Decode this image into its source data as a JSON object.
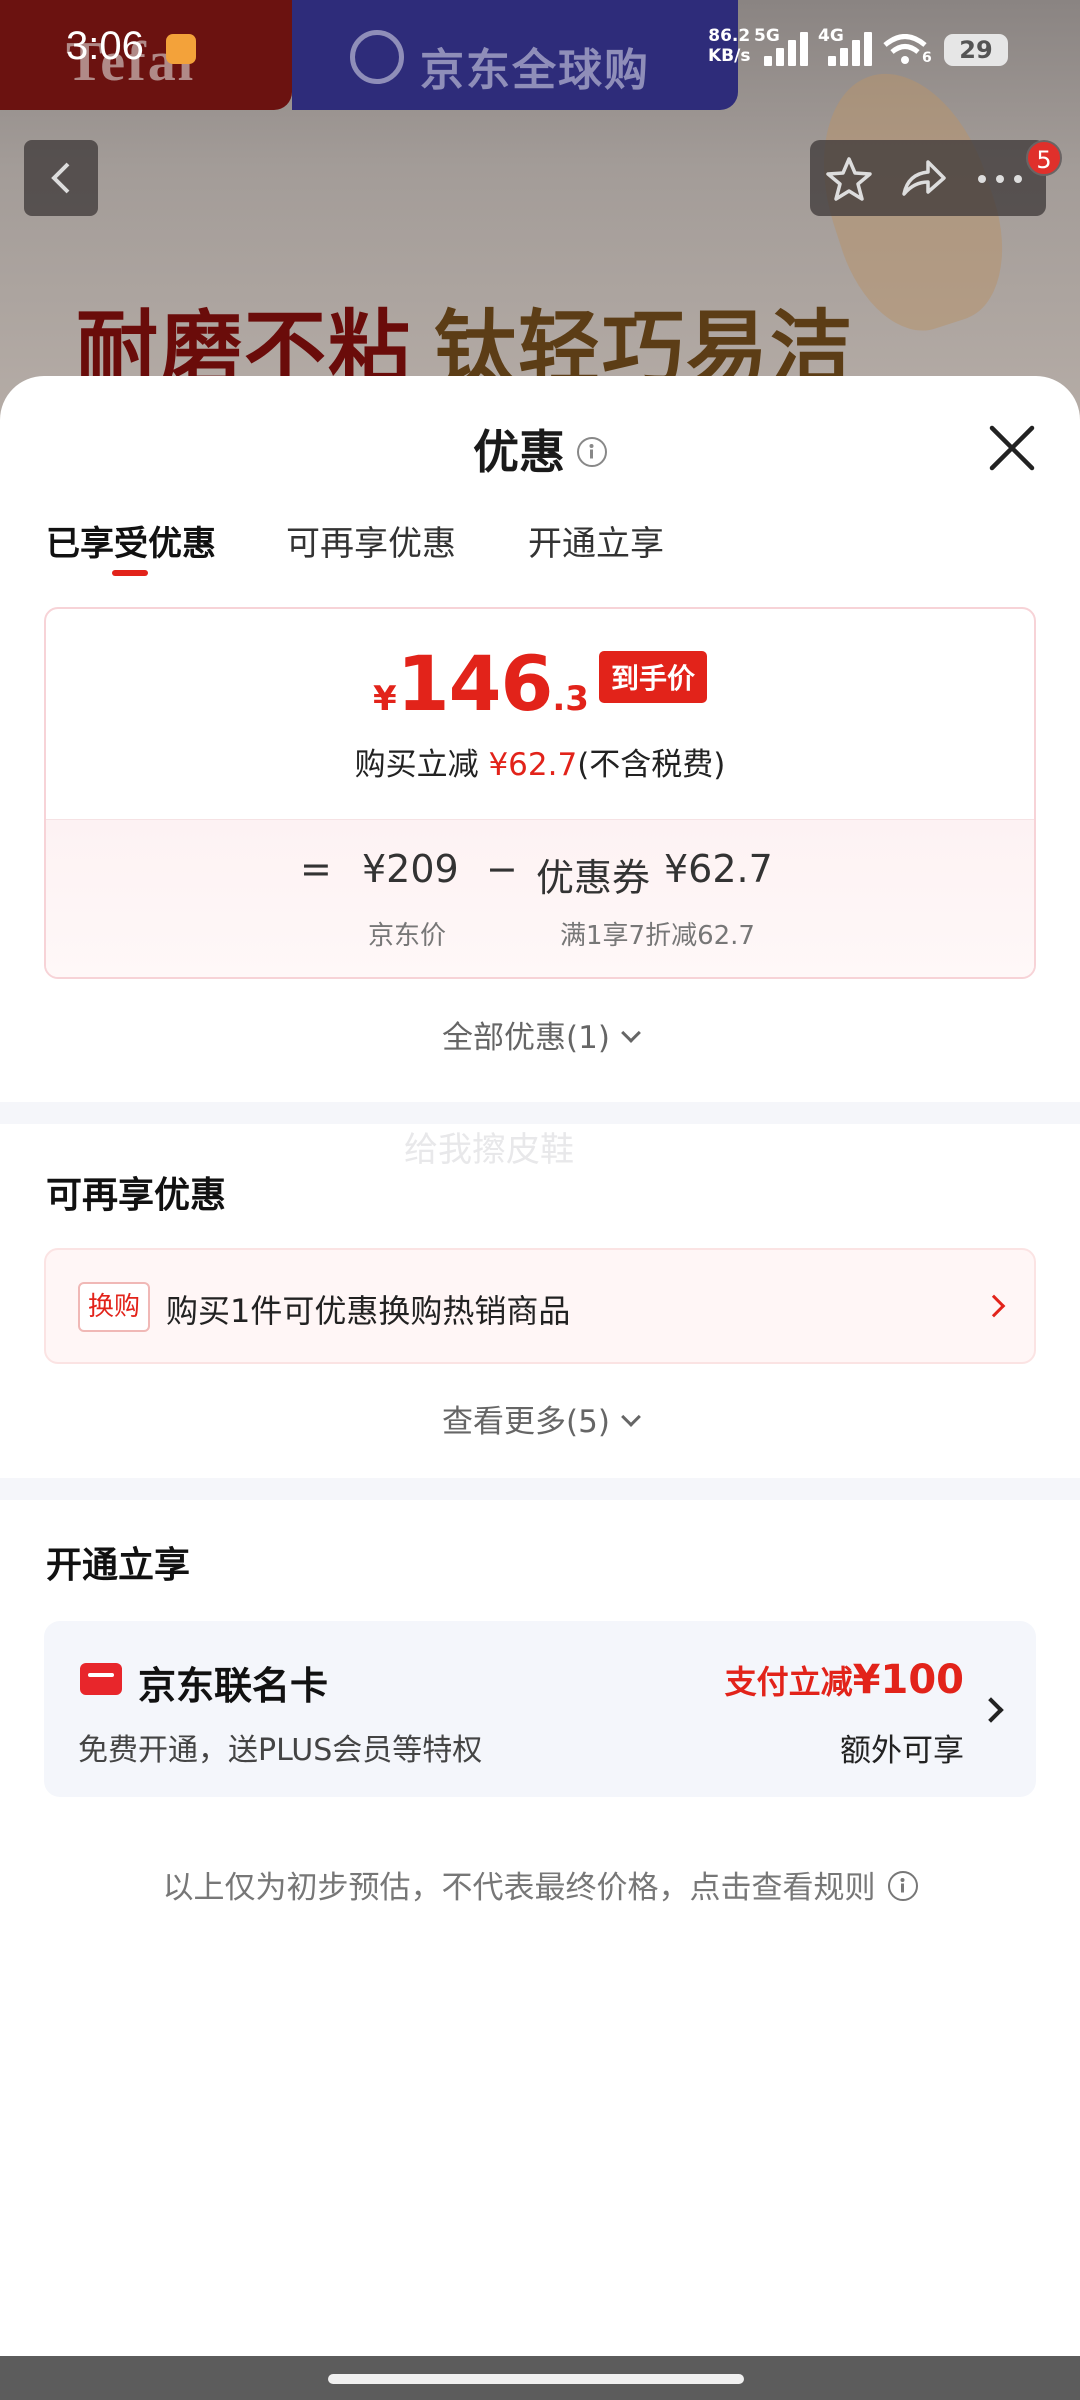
{
  "status_bar": {
    "time": "3:06",
    "net_speed_value": "86.2",
    "net_speed_unit": "KB/s",
    "signal1_label": "5G",
    "signal2_label": "4G",
    "wifi_sub": "6",
    "battery": "29"
  },
  "background": {
    "brand_left": "Tefal",
    "brand_right": "京东全球购",
    "slogan_part1": "耐磨不粘",
    "slogan_part2": "钛轻巧易洁",
    "nav_badge_count": "5"
  },
  "sheet": {
    "title": "优惠",
    "tabs": [
      {
        "label": "已享受优惠",
        "active": true
      },
      {
        "label": "可再享优惠",
        "active": false
      },
      {
        "label": "开通立享",
        "active": false
      }
    ],
    "price_card": {
      "currency": "¥",
      "final_price_int": "146",
      "final_price_dec": ".3",
      "final_price_tag": "到手价",
      "discount_prefix": "购买立减",
      "discount_amount": "¥62.7",
      "discount_suffix": "(不含税费)",
      "formula": {
        "equals": "=",
        "base_price": "¥209",
        "minus": "−",
        "coupon_label": "优惠券",
        "coupon_amount": "¥62.7",
        "base_price_label": "京东价",
        "coupon_desc": "满1享7折减62.7"
      }
    },
    "all_discounts_label": "全部优惠(1)",
    "watermark": "给我擦皮鞋",
    "section_more": {
      "title": "可再享优惠",
      "promo_tag": "换购",
      "promo_text": "购买1件可优惠换购热销商品",
      "see_more_label": "查看更多(5)"
    },
    "section_open": {
      "title": "开通立享",
      "card_title": "京东联名卡",
      "card_subtitle": "免费开通，送PLUS会员等特权",
      "right_prefix": "支付立减",
      "right_amount": "¥100",
      "right_sub": "额外可享"
    },
    "disclaimer": "以上仅为初步预估，不代表最终价格，点击查看规则"
  },
  "colors": {
    "accent_red": "#e2231a",
    "card_bg": "#f4f6fb",
    "promo_bg": "#fff6f6"
  }
}
